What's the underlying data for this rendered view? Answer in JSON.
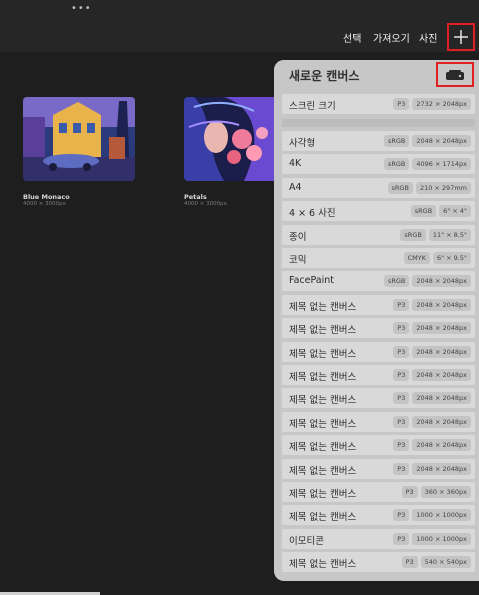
{
  "topbar": {
    "dots": "•••",
    "menu": [
      "선택",
      "가져오기",
      "사진"
    ],
    "plus_icon": "plus-icon"
  },
  "gallery": {
    "items": [
      {
        "title": "Blue Monaco",
        "size": "4000 × 3000px"
      },
      {
        "title": "Petals",
        "size": "4000 × 3000px"
      }
    ]
  },
  "panel": {
    "title": "새로운 캔버스",
    "folder_icon": "new-canvas-folder-icon",
    "top_row": {
      "label": "스크린 크기",
      "color": "P3",
      "dims": "2732 × 2048px"
    },
    "rows": [
      {
        "label": "사각형",
        "color": "sRGB",
        "dims": "2048 × 2048px"
      },
      {
        "label": "4K",
        "color": "sRGB",
        "dims": "4096 × 1714px"
      },
      {
        "label": "A4",
        "color": "sRGB",
        "dims": "210 × 297mm"
      },
      {
        "label": "4 × 6 사진",
        "color": "sRGB",
        "dims": "6\" × 4\""
      },
      {
        "label": "종이",
        "color": "sRGB",
        "dims": "11\" × 8.5\""
      },
      {
        "label": "코믹",
        "color": "CMYK",
        "dims": "6\" × 9.5\""
      },
      {
        "label": "FacePaint",
        "color": "sRGB",
        "dims": "2048 × 2048px"
      },
      {
        "label": "제목 없는 캔버스",
        "color": "P3",
        "dims": "2048 × 2048px"
      },
      {
        "label": "제목 없는 캔버스",
        "color": "P3",
        "dims": "2048 × 2048px"
      },
      {
        "label": "제목 없는 캔버스",
        "color": "P3",
        "dims": "2048 × 2048px"
      },
      {
        "label": "제목 없는 캔버스",
        "color": "P3",
        "dims": "2048 × 2048px"
      },
      {
        "label": "제목 없는 캔버스",
        "color": "P3",
        "dims": "2048 × 2048px"
      },
      {
        "label": "제목 없는 캔버스",
        "color": "P3",
        "dims": "2048 × 2048px"
      },
      {
        "label": "제목 없는 캔버스",
        "color": "P3",
        "dims": "2048 × 2048px"
      },
      {
        "label": "제목 없는 캔버스",
        "color": "P3",
        "dims": "2048 × 2048px"
      },
      {
        "label": "제목 없는 캔버스",
        "color": "P3",
        "dims": "360 × 360px"
      },
      {
        "label": "제목 없는 캔버스",
        "color": "P3",
        "dims": "1000 × 1000px"
      },
      {
        "label": "이모티콘",
        "color": "P3",
        "dims": "1000 × 1000px"
      },
      {
        "label": "제목 없는 캔버스",
        "color": "P3",
        "dims": "540 × 540px"
      }
    ]
  },
  "colors": {
    "highlight": "#e02020",
    "panel_bg": "#c7c7c7",
    "row_bg": "#d9d9d9",
    "app_bg": "#1e1e1e"
  }
}
